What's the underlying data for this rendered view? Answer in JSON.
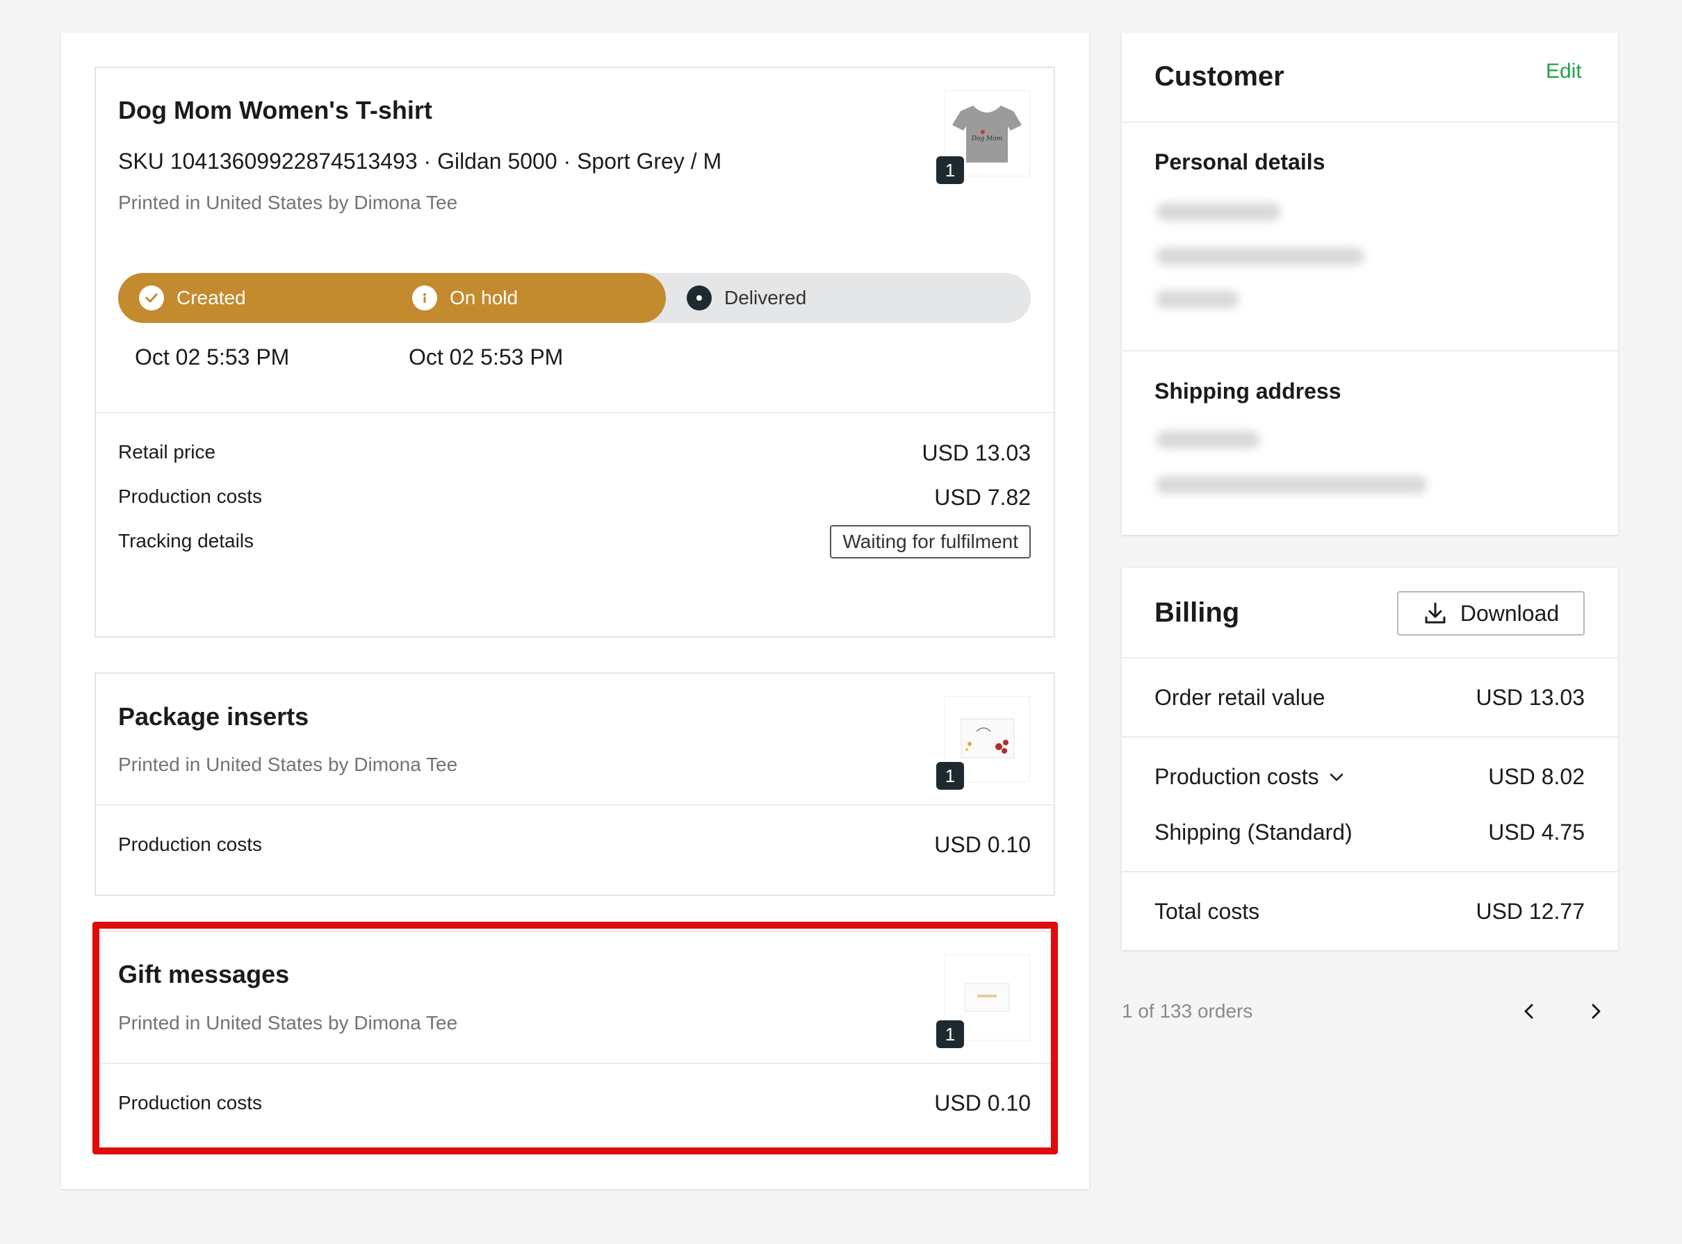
{
  "product": {
    "title": "Dog Mom Women's T-shirt",
    "sku_line": "SKU 10413609922874513493  · Gildan 5000 · Sport Grey / M",
    "printed_by": "Printed in United States by Dimona Tee",
    "quantity": "1",
    "thumb_text": "Dog Mom",
    "steps": [
      {
        "label": "Created",
        "date": "Oct 02 5:53 PM"
      },
      {
        "label": "On hold",
        "date": "Oct 02 5:53 PM"
      },
      {
        "label": "Delivered",
        "date": ""
      }
    ],
    "retail_label": "Retail price",
    "retail_value": "USD 13.03",
    "production_label": "Production costs",
    "production_value": "USD 7.82",
    "tracking_label": "Tracking details",
    "tracking_status": "Waiting for fulfilment"
  },
  "inserts": {
    "title": "Package inserts",
    "printed_by": "Printed in United States by Dimona Tee",
    "quantity": "1",
    "production_label": "Production costs",
    "production_value": "USD 0.10"
  },
  "gift": {
    "title": "Gift messages",
    "printed_by": "Printed in United States by Dimona Tee",
    "quantity": "1",
    "production_label": "Production costs",
    "production_value": "USD 0.10"
  },
  "customer": {
    "title": "Customer",
    "edit_label": "Edit",
    "personal_details": "Personal details",
    "shipping_address": "Shipping address"
  },
  "billing": {
    "title": "Billing",
    "download_label": "Download",
    "order_retail_label": "Order retail value",
    "order_retail_value": "USD 13.03",
    "production_label": "Production costs",
    "production_value": "USD 8.02",
    "shipping_label": "Shipping (Standard)",
    "shipping_value": "USD 4.75",
    "total_label": "Total costs",
    "total_value": "USD 12.77"
  },
  "pagination": {
    "text": "1 of 133 orders"
  },
  "colors": {
    "progress": "#c48a2e",
    "accent_green": "#1fa34a",
    "highlight_red": "#e00b0b"
  }
}
